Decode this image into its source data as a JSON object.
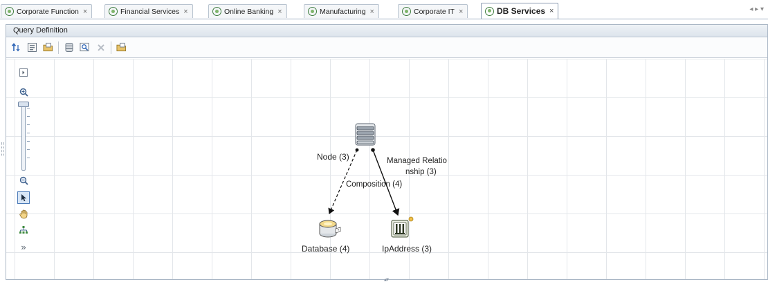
{
  "tabs": [
    {
      "label": "Corporate Function",
      "active": false
    },
    {
      "label": "Financial Services",
      "active": false
    },
    {
      "label": "Online Banking",
      "active": false
    },
    {
      "label": "Manufacturing",
      "active": false
    },
    {
      "label": "Corporate IT",
      "active": false
    },
    {
      "label": "DB Services",
      "active": true
    }
  ],
  "tab_close_glyph": "×",
  "tab_scroll_glyph": "◂ ▸ ▾",
  "panel": {
    "title": "Query Definition"
  },
  "toolbar": {
    "buttons": [
      {
        "name": "sort-up-icon"
      },
      {
        "name": "properties-icon"
      },
      {
        "name": "open-folder-icon"
      },
      {
        "name": "database-icon"
      },
      {
        "name": "preview-icon"
      },
      {
        "name": "delete-icon",
        "disabled": true
      },
      {
        "name": "open-icon"
      }
    ]
  },
  "side_tools": {
    "expand_glyph": "⊡",
    "zoom_in": "zoom-in-icon",
    "zoom_out": "zoom-out-icon",
    "select": "pointer-icon",
    "pan": "hand-icon",
    "layout": "layout-icon",
    "more_glyph": "»",
    "zoom_level": 1.0
  },
  "diagram": {
    "nodes": {
      "node": {
        "label": "Node (3)"
      },
      "database": {
        "label": "Database (4)"
      },
      "ipaddress": {
        "label": "IpAddress (3)"
      }
    },
    "edges": {
      "composition": {
        "label": "Composition (4)"
      },
      "managed": {
        "label_line1": "Managed Relatio",
        "label_line2": "nship (3)"
      }
    }
  },
  "colors": {
    "accent_green": "#3f7d3f",
    "selection_blue": "#4a7ab8",
    "grid": "#e3e6ea"
  }
}
